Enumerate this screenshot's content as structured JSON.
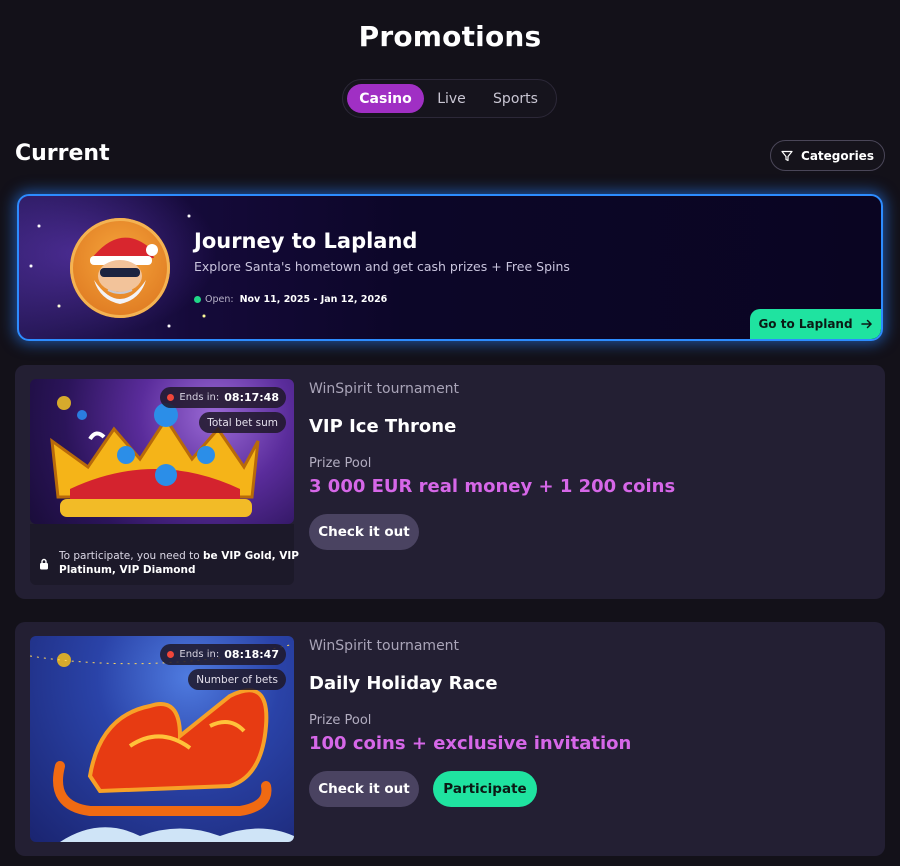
{
  "page": {
    "title": "Promotions"
  },
  "tabs": [
    {
      "label": "Casino",
      "active": true
    },
    {
      "label": "Live",
      "active": false
    },
    {
      "label": "Sports",
      "active": false
    }
  ],
  "section": {
    "title": "Current",
    "categories_label": "Categories"
  },
  "featured": {
    "title": "Journey to Lapland",
    "subtitle": "Explore Santa's hometown and get cash prizes + Free Spins",
    "status": "Open:",
    "dates": "Nov 11, 2025 - Jan 12, 2026",
    "cta": "Go to Lapland",
    "accent": "#1fe3a0",
    "border_color": "#2d8cff"
  },
  "tournaments": [
    {
      "kind": "WinSpirit tournament",
      "name": "VIP Ice Throne",
      "ends_label": "Ends in:",
      "ends_time": "08:17:48",
      "type": "Total bet sum",
      "prize_label": "Prize Pool",
      "prize": "3 000 EUR real money + 1 200 coins",
      "lock_note_prefix": "To participate, you need to ",
      "lock_note_req": "be VIP Gold, VIP Platinum, VIP Diamond",
      "check_label": "Check it out"
    },
    {
      "kind": "WinSpirit tournament",
      "name": "Daily Holiday Race",
      "ends_label": "Ends in:",
      "ends_time": "08:18:47",
      "type": "Number of bets",
      "prize_label": "Prize Pool",
      "prize": "100 coins + exclusive invitation",
      "check_label": "Check it out",
      "participate_label": "Participate"
    }
  ],
  "colors": {
    "tab_active": "#a02fc4",
    "prize": "#d667e8",
    "card_bg": "#231f33"
  }
}
